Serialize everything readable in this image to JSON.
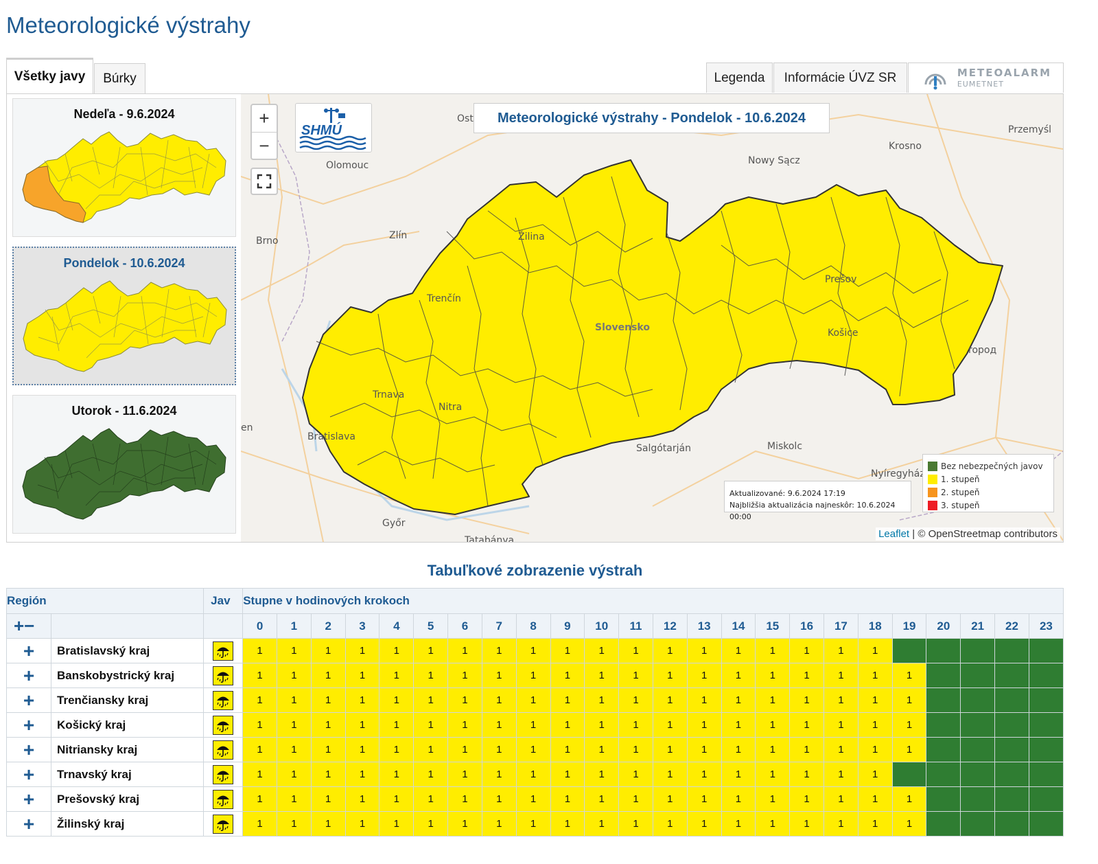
{
  "page": {
    "title": "Meteorologické výstrahy"
  },
  "tabs": {
    "left": [
      "Všetky javy",
      "Búrky"
    ],
    "right": {
      "legend": "Legenda",
      "uvz": "Informácie ÚVZ SR",
      "meteoalarm_main": "METEOALARM",
      "meteoalarm_sub": "EUMETNET"
    }
  },
  "days": [
    {
      "label": "Nedeľa - 9.6.2024",
      "status": "yellow-orange-west"
    },
    {
      "label": "Pondelok - 10.6.2024",
      "status": "yellow",
      "selected": true
    },
    {
      "label": "Utorok - 11.6.2024",
      "status": "green"
    }
  ],
  "map": {
    "title": "Meteorologické výstrahy - Pondelok - 10.6.2024",
    "logo_text": "SHMÚ",
    "zoom_in": "+",
    "zoom_out": "−",
    "cities": [
      "Ostrava",
      "Olomouc",
      "Brno",
      "Zlín",
      "Žilina",
      "Trenčín",
      "Trnava",
      "Nitra",
      "Bratislava",
      "Győr",
      "Tatabánya",
      "Salgótarján",
      "Miskolc",
      "Nyíregyháza",
      "Slovensko",
      "Prešov",
      "Košice",
      "Nowy Sącz",
      "Krosno",
      "Przemyśl",
      "Ужгород"
    ],
    "city_labels": {
      "ostrava": "Ost",
      "olomouc": "Olomouc",
      "brno": "Brno",
      "zlin": "Zlín",
      "zilina": "Žilina",
      "trencin": "Trenčín",
      "trnava": "Trnava",
      "nitra": "Nitra",
      "bratislava": "Bratislava",
      "gyor": "Győr",
      "tatabanya": "Tatabánya",
      "salgotarjan": "Salgótarján",
      "miskolc": "Miskolc",
      "nyiregyhaza": "Nyíregyház",
      "slovensko": "Slovensko",
      "presov": "Prešov",
      "kosice": "Košice",
      "nowysacz": "Nowy Sącz",
      "krosno": "Krosno",
      "przemysl": "Przemyśl",
      "uzhhorod": "ropoд",
      "en": "en"
    },
    "update": {
      "line1": "Aktualizované: 9.6.2024 17:19",
      "line2": "Najbližšia aktualizácia najneskôr: 10.6.2024 00:00"
    },
    "legend": [
      {
        "label": "Bez nebezpečných javov",
        "color": "#4a7a32"
      },
      {
        "label": "1. stupeň",
        "color": "#ffed00"
      },
      {
        "label": "2. stupeň",
        "color": "#f7941d"
      },
      {
        "label": "3. stupeň",
        "color": "#ee1c25"
      }
    ],
    "attribution": {
      "leaflet": "Leaflet",
      "rest": "| © OpenStreetmap contributors"
    }
  },
  "table": {
    "title": "Tabuľkové zobrazenie výstrah",
    "headers": {
      "region": "Región",
      "phenomenon": "Jav",
      "steps": "Stupne v hodinových krokoch",
      "expand_all": "+−"
    },
    "hours": [
      "0",
      "1",
      "2",
      "3",
      "4",
      "5",
      "6",
      "7",
      "8",
      "9",
      "10",
      "11",
      "12",
      "13",
      "14",
      "15",
      "16",
      "17",
      "18",
      "19",
      "20",
      "21",
      "22",
      "23"
    ],
    "rows": [
      {
        "region": "Bratislavský kraj",
        "levels": [
          1,
          1,
          1,
          1,
          1,
          1,
          1,
          1,
          1,
          1,
          1,
          1,
          1,
          1,
          1,
          1,
          1,
          1,
          1,
          0,
          0,
          0,
          0,
          0
        ]
      },
      {
        "region": "Banskobystrický kraj",
        "levels": [
          1,
          1,
          1,
          1,
          1,
          1,
          1,
          1,
          1,
          1,
          1,
          1,
          1,
          1,
          1,
          1,
          1,
          1,
          1,
          1,
          0,
          0,
          0,
          0
        ]
      },
      {
        "region": "Trenčiansky kraj",
        "levels": [
          1,
          1,
          1,
          1,
          1,
          1,
          1,
          1,
          1,
          1,
          1,
          1,
          1,
          1,
          1,
          1,
          1,
          1,
          1,
          1,
          0,
          0,
          0,
          0
        ]
      },
      {
        "region": "Košický kraj",
        "levels": [
          1,
          1,
          1,
          1,
          1,
          1,
          1,
          1,
          1,
          1,
          1,
          1,
          1,
          1,
          1,
          1,
          1,
          1,
          1,
          1,
          0,
          0,
          0,
          0
        ]
      },
      {
        "region": "Nitriansky kraj",
        "levels": [
          1,
          1,
          1,
          1,
          1,
          1,
          1,
          1,
          1,
          1,
          1,
          1,
          1,
          1,
          1,
          1,
          1,
          1,
          1,
          1,
          0,
          0,
          0,
          0
        ]
      },
      {
        "region": "Trnavský kraj",
        "levels": [
          1,
          1,
          1,
          1,
          1,
          1,
          1,
          1,
          1,
          1,
          1,
          1,
          1,
          1,
          1,
          1,
          1,
          1,
          1,
          0,
          0,
          0,
          0,
          0
        ]
      },
      {
        "region": "Prešovský kraj",
        "levels": [
          1,
          1,
          1,
          1,
          1,
          1,
          1,
          1,
          1,
          1,
          1,
          1,
          1,
          1,
          1,
          1,
          1,
          1,
          1,
          1,
          0,
          0,
          0,
          0
        ]
      },
      {
        "region": "Žilinský kraj",
        "levels": [
          1,
          1,
          1,
          1,
          1,
          1,
          1,
          1,
          1,
          1,
          1,
          1,
          1,
          1,
          1,
          1,
          1,
          1,
          1,
          1,
          0,
          0,
          0,
          0
        ]
      }
    ],
    "expand_symbol": "+",
    "phenomenon_icon": "umbrella-rain-icon"
  }
}
